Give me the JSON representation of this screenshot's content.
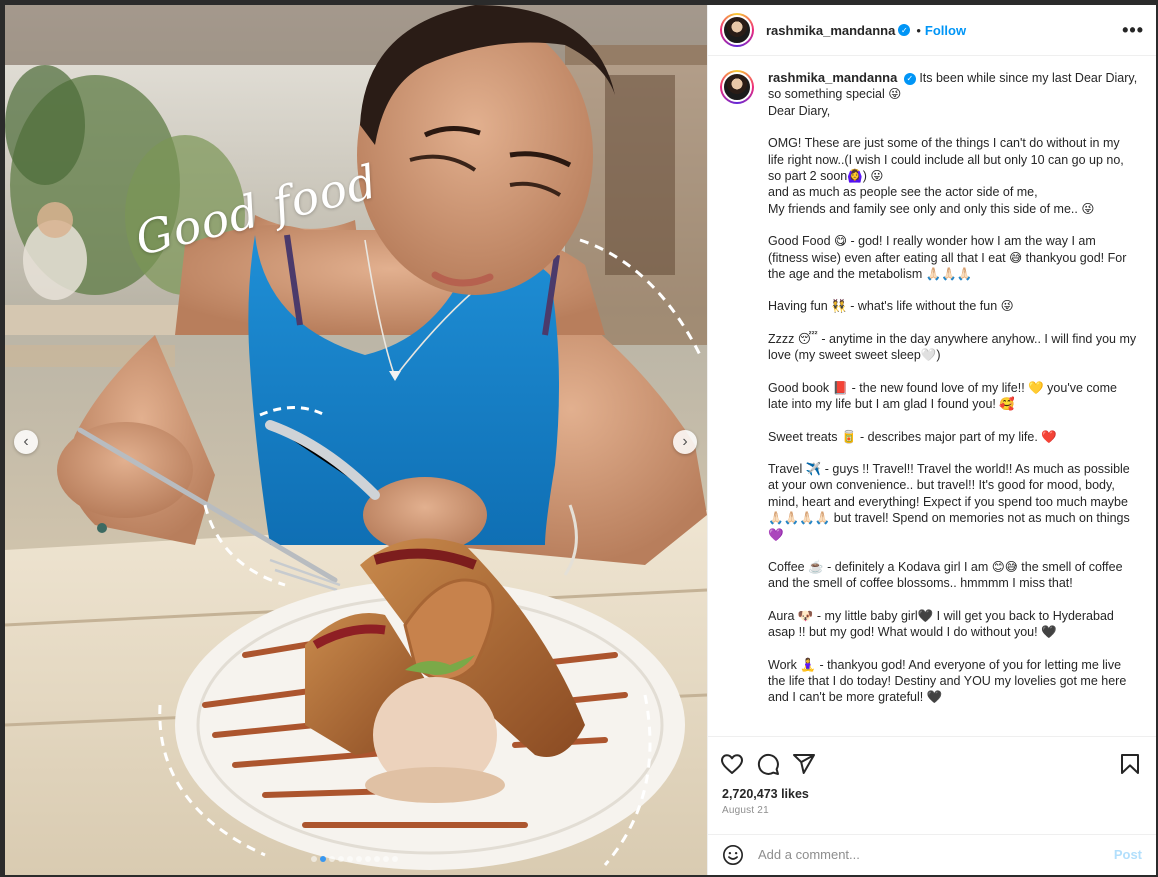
{
  "post": {
    "username": "rashmika_mandanna",
    "follow_label": "Follow",
    "separator": "•",
    "more_label": "•••",
    "image_overlay_text": "Good food",
    "carousel_total": 10,
    "carousel_active_index": 1
  },
  "caption": {
    "intro": "Its been while since my last Dear Diary, so something special 😜",
    "paragraphs": [
      "Dear Diary,",
      "OMG! These are just some of the things I can't do without in my life right now..(I wish I could include all but only 10 can go up no, so part 2 soon🙆‍♀️) 😛\nand as much as people see the actor side of me,\nMy friends and family see only and only this side of me.. 😜",
      "Good Food 😋 - god! I really wonder how I am the way I am (fitness wise) even after eating all that I eat 😅 thankyou god! For the age and the metabolism 🙏🏻🙏🏻🙏🏻",
      "Having fun 👯 - what's life without the fun 😜",
      "Zzzz 😴 - anytime in the day anywhere anyhow.. I will find you my love (my sweet sweet sleep🤍)",
      "Good book 📕 - the new found love of my life!! 💛 you've come late into my life but I am glad I found you! 🥰",
      "Sweet treats 🥫 - describes major part of my life. ❤️",
      "Travel ✈️ - guys !! Travel!! Travel the world!! As much as possible at your own convenience.. but travel!! It's good for mood, body, mind, heart and everything! Expect if you spend too much maybe 🙏🏻🙏🏻🙏🏻🙏🏻 but travel! Spend on memories not as much on things 💜",
      "Coffee ☕️ - definitely a Kodava girl I am 😊😅 the smell of coffee and the smell of coffee blossoms.. hmmmm I miss that!",
      "Aura 🐶 - my little baby girl🖤 I will get you back to Hyderabad asap !! but my god! What would I do without you! 🖤",
      "Work 🧘‍♀️ - thankyou god! And everyone of you for letting me live the life that I do today! Destiny and YOU my lovelies got me here and I can't be more grateful! 🖤"
    ]
  },
  "stats": {
    "likes": "2,720,473 likes",
    "date": "August 21"
  },
  "comment_box": {
    "placeholder": "Add a comment...",
    "post_label": "Post"
  },
  "icons": {
    "like": "heart-icon",
    "comment": "comment-icon",
    "share": "share-icon",
    "save": "bookmark-icon",
    "emoji": "emoji-icon",
    "verified": "verified-badge-icon",
    "prev": "chevron-left-icon",
    "next": "chevron-right-icon"
  },
  "colors": {
    "accent": "#0095f6",
    "post_disabled": "#b2dffc",
    "text": "#262626",
    "muted": "#8e8e8e"
  }
}
